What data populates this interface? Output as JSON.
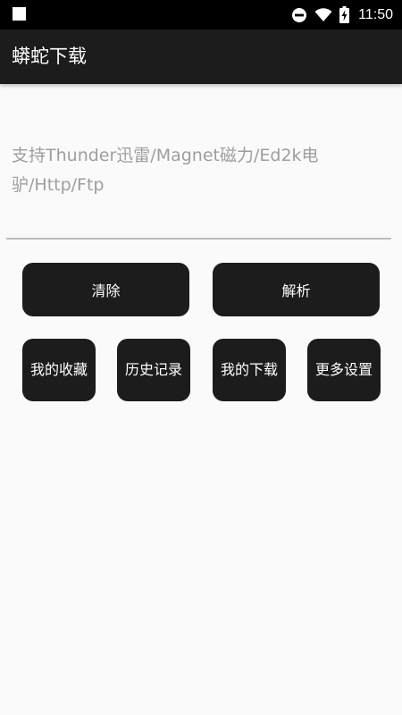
{
  "status_bar": {
    "time": "11:50",
    "icons": [
      "notification-square-icon",
      "do-not-disturb-icon",
      "wifi-icon",
      "battery-charging-icon"
    ]
  },
  "app_bar": {
    "title": "蟒蛇下载"
  },
  "input": {
    "value": "",
    "placeholder": "支持Thunder迅雷/Magnet磁力/Ed2k电驴/Http/Ftp"
  },
  "actions": {
    "clear_label": "清除",
    "parse_label": "解析"
  },
  "menu": {
    "favorites_label": "我的收藏",
    "history_label": "历史记录",
    "downloads_label": "我的下载",
    "settings_label": "更多设置"
  },
  "colors": {
    "status_bar": "#000000",
    "app_bar": "#1c1c1c",
    "button": "#1c1c1c",
    "background": "#fafafa",
    "hint_text": "#9e9e9e",
    "underline": "#bdbdbd"
  }
}
